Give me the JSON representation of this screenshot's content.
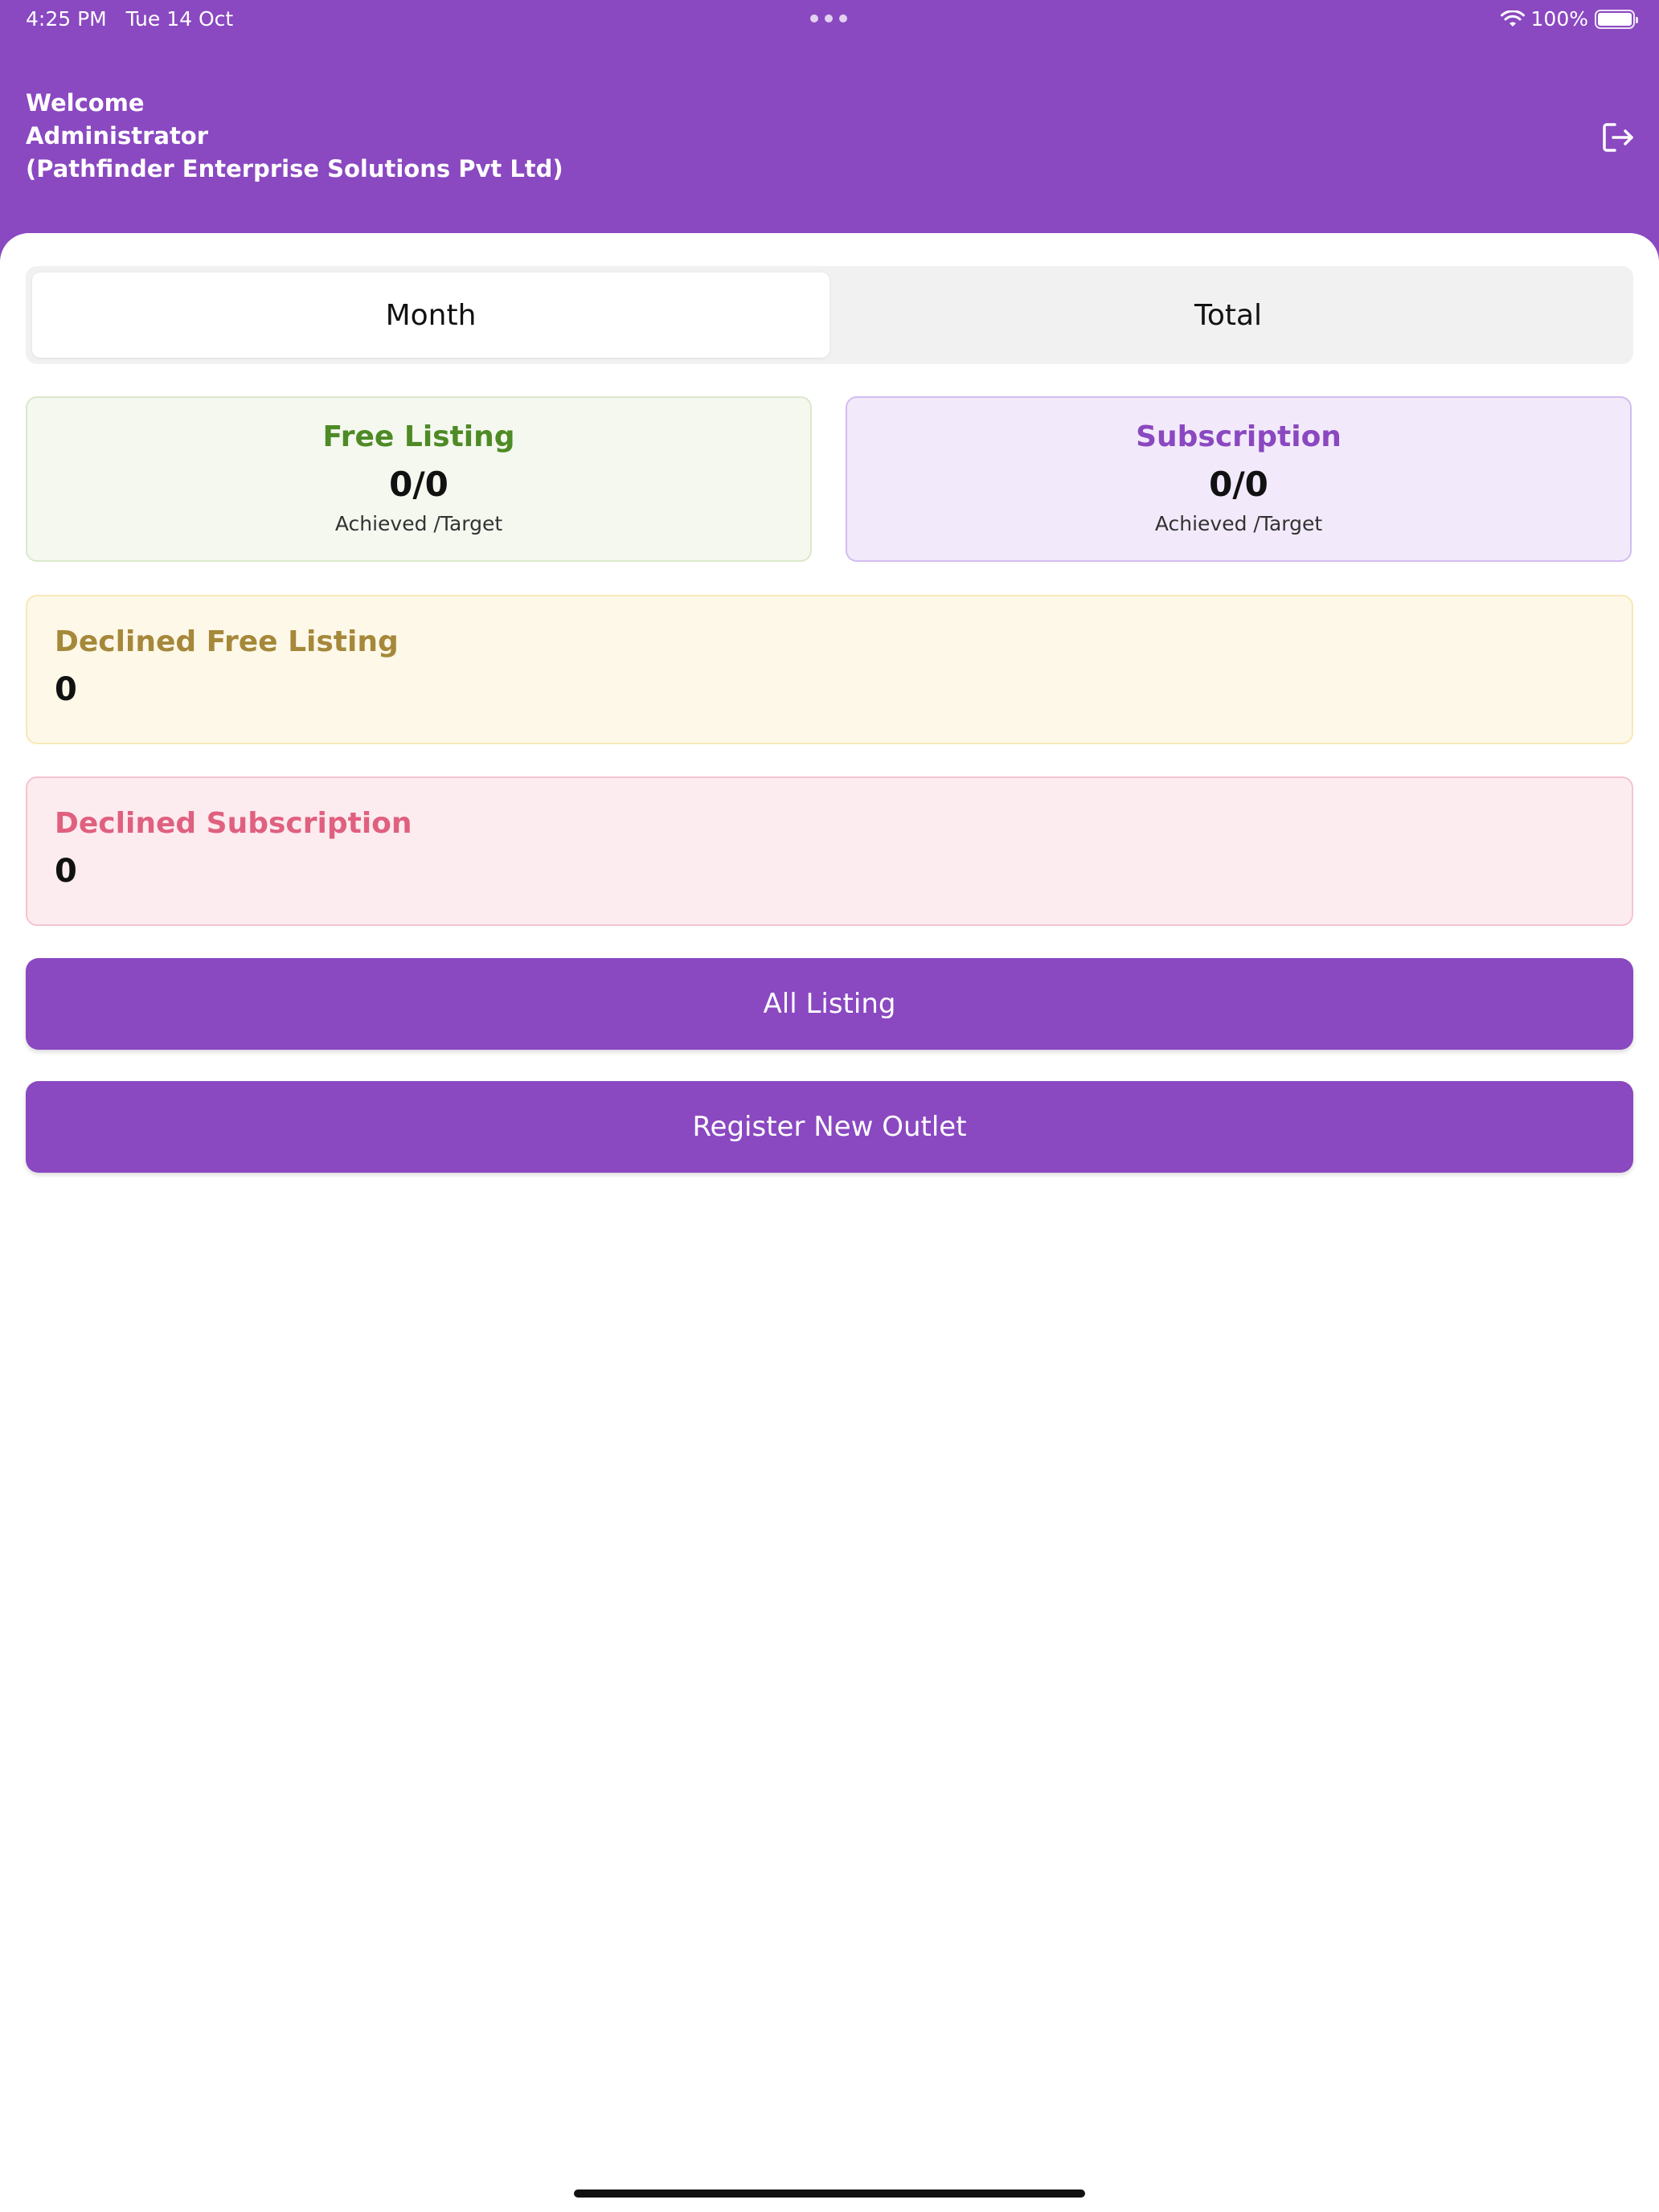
{
  "status_bar": {
    "time": "4:25 PM",
    "date": "Tue 14 Oct",
    "battery": "100%",
    "battery_level": 1.0,
    "icons": [
      "wifi-icon",
      "battery-icon"
    ]
  },
  "header": {
    "line1": "Welcome",
    "line2": "Administrator",
    "line3": "(Pathfinder Enterprise Solutions Pvt Ltd)",
    "logout_icon": "logout-icon"
  },
  "tabs": [
    {
      "label": "Month",
      "active": true
    },
    {
      "label": "Total",
      "active": false
    }
  ],
  "cards": {
    "free_listing": {
      "title": "Free Listing",
      "value": "0/0",
      "caption": "Achieved /Target"
    },
    "subscription": {
      "title": "Subscription",
      "value": "0/0",
      "caption": "Achieved /Target"
    },
    "declined_free": {
      "title": "Declined Free Listing",
      "value": "0"
    },
    "declined_sub": {
      "title": "Declined Subscription",
      "value": "0"
    }
  },
  "buttons": {
    "all_listing": "All Listing",
    "register": "Register New Outlet"
  },
  "colors": {
    "primary": "#8a48c1",
    "free_listing": "#4e8a25",
    "declined_free": "#a6883a",
    "declined_sub": "#e0607f"
  }
}
